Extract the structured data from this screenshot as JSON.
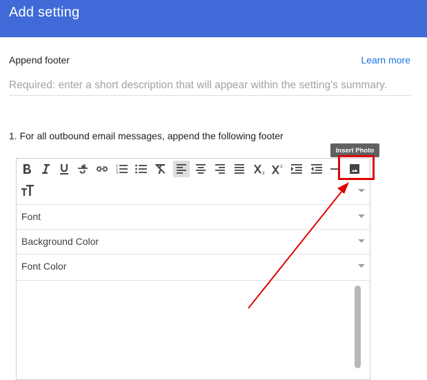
{
  "dialog": {
    "title": "Add setting"
  },
  "setting": {
    "name": "Append footer",
    "learn_more": "Learn more",
    "description_value": "",
    "description_placeholder": "Required: enter a short description that will appear within the setting's summary."
  },
  "rule": {
    "text": "1. For all outbound email messages, append the following footer"
  },
  "editor": {
    "toolbar_icons": [
      "bold-icon",
      "italic-icon",
      "underline-icon",
      "strikethrough-icon",
      "link-icon",
      "numbered-list-icon",
      "bulleted-list-icon",
      "clear-formatting-icon",
      "align-left-icon",
      "align-center-icon",
      "align-right-icon",
      "align-justify-icon",
      "subscript-icon",
      "superscript-icon",
      "indent-icon",
      "outdent-icon",
      "horizontal-rule-icon",
      "insert-photo-icon"
    ],
    "tooltip": "Insert Photo",
    "rows": {
      "font": "Font",
      "background_color": "Background Color",
      "font_color": "Font Color"
    },
    "accent_color": "#3f6ad8",
    "highlight_color": "#e00000"
  }
}
